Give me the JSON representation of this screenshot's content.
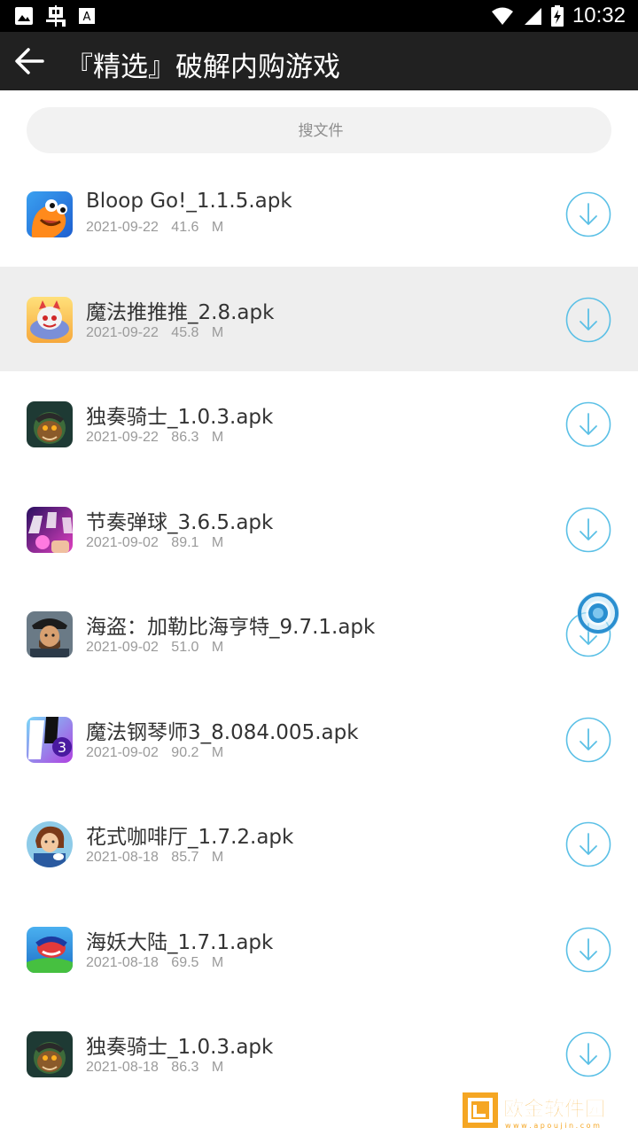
{
  "status_bar": {
    "time": "10:32",
    "left_icons": [
      "image-icon",
      "bug-icon",
      "font-icon"
    ],
    "right_icons": [
      "wifi-icon",
      "signal-icon",
      "battery-charging-icon"
    ]
  },
  "app_bar": {
    "back_icon": "arrow-left-icon",
    "title": "『精选』破解内购游戏"
  },
  "search": {
    "placeholder": "搜文件"
  },
  "files": [
    {
      "name": "Bloop Go!_1.1.5.apk",
      "date": "2021-09-22",
      "size": "41.6 M",
      "icon": "bloop-go-icon",
      "selected": false
    },
    {
      "name": "魔法推推推_2.8.apk",
      "date": "2021-09-22",
      "size": "45.8 M",
      "icon": "magic-push-icon",
      "selected": true
    },
    {
      "name": "独奏骑士_1.0.3.apk",
      "date": "2021-09-22",
      "size": "86.3 M",
      "icon": "solo-knight-icon",
      "selected": false
    },
    {
      "name": "节奏弹球_3.6.5.apk",
      "date": "2021-09-02",
      "size": "89.1 M",
      "icon": "rhythm-ball-icon",
      "selected": false
    },
    {
      "name": "海盗：加勒比海亨特_9.7.1.apk",
      "date": "2021-09-02",
      "size": "51.0 M",
      "icon": "pirate-icon",
      "selected": false
    },
    {
      "name": "魔法钢琴师3_8.084.005.apk",
      "date": "2021-09-02",
      "size": "90.2 M",
      "icon": "magic-piano-icon",
      "selected": false
    },
    {
      "name": "花式咖啡厅_1.7.2.apk",
      "date": "2021-08-18",
      "size": "85.7 M",
      "icon": "cafe-icon",
      "selected": false
    },
    {
      "name": "海妖大陆_1.7.1.apk",
      "date": "2021-08-18",
      "size": "69.5 M",
      "icon": "sea-monster-icon",
      "selected": false
    },
    {
      "name": "独奏骑士_1.0.3.apk",
      "date": "2021-08-18",
      "size": "86.3 M",
      "icon": "solo-knight-icon",
      "selected": false
    }
  ],
  "watermark": {
    "text": "欧金软件园",
    "url_text": "w w w . a p o u j i n . c o m"
  },
  "colors": {
    "accent": "#5bc0e6",
    "app_bar": "#212121",
    "selected_row": "#eeeeee"
  }
}
